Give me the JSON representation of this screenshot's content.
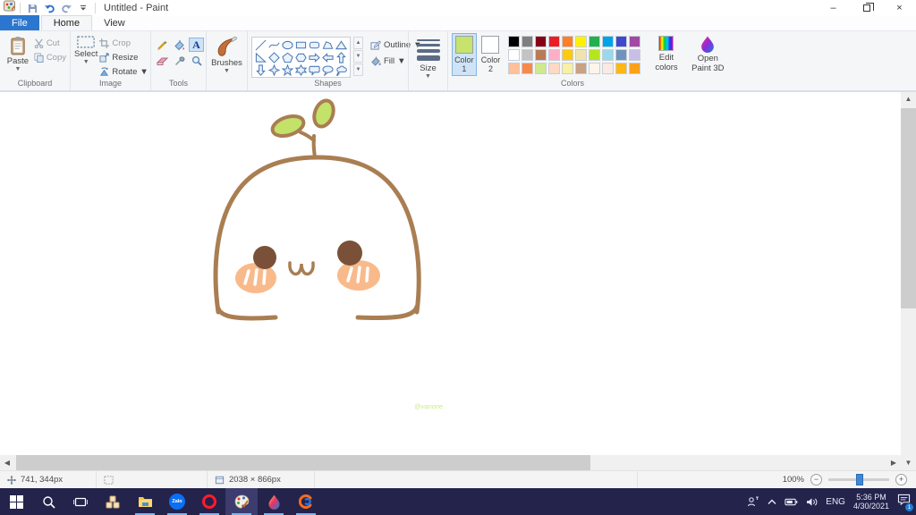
{
  "window": {
    "title": "Untitled - Paint"
  },
  "quick_access": {
    "save": "Save",
    "undo": "Undo",
    "redo": "Redo",
    "customize": "Customize Quick Access Toolbar"
  },
  "tabs": {
    "file": "File",
    "home": "Home",
    "view": "View"
  },
  "ribbon": {
    "clipboard": {
      "label": "Clipboard",
      "paste": "Paste",
      "cut": "Cut",
      "copy": "Copy"
    },
    "image": {
      "label": "Image",
      "select": "Select",
      "crop": "Crop",
      "resize": "Resize",
      "rotate": "Rotate"
    },
    "tools": {
      "label": "Tools",
      "items": [
        "pencil",
        "fill-bucket",
        "text",
        "eraser",
        "eyedropper",
        "magnifier"
      ],
      "selected": "text"
    },
    "brushes": {
      "label": "Brushes"
    },
    "shapes": {
      "label": "Shapes",
      "items": [
        "line",
        "curve",
        "ellipse",
        "rectangle",
        "rounded-rectangle",
        "polygon",
        "triangle",
        "right-triangle",
        "diamond",
        "pentagon",
        "hexagon",
        "arrow-right",
        "arrow-left",
        "arrow-up",
        "arrow-down",
        "star-4",
        "star-5",
        "star-6",
        "callout-rounded",
        "callout-oval",
        "callout-cloud"
      ],
      "outline": "Outline",
      "fill": "Fill"
    },
    "size": {
      "label": "Size"
    },
    "colors": {
      "label": "Colors",
      "color1": {
        "line1": "Color",
        "line2": "1",
        "value": "#c6e36d"
      },
      "color2": {
        "line1": "Color",
        "line2": "2",
        "value": "#ffffff"
      },
      "palette_rows": [
        [
          "#000000",
          "#7f7f7f",
          "#880015",
          "#ed1c24",
          "#ff7f27",
          "#fff200",
          "#22b14c",
          "#00a2e8",
          "#3f48cc",
          "#a349a4"
        ],
        [
          "#ffffff",
          "#c3c3c3",
          "#b97a57",
          "#ffaec9",
          "#ffc90e",
          "#efe4b0",
          "#b5e61d",
          "#99d9ea",
          "#7092be",
          "#c8bfe7"
        ],
        [
          "#ffc09a",
          "#f68a4c",
          "#cfe98c",
          "#ffd9c4",
          "#f8f0a2",
          "#c9a184",
          "#fdf5ec",
          "#fbe9e4",
          "#fdb813",
          "#f9a11b"
        ]
      ],
      "edit_colors_line1": "Edit",
      "edit_colors_line2": "colors",
      "open_line1": "Open",
      "open_line2": "Paint 3D"
    }
  },
  "canvas": {
    "signature": "@vanone",
    "artwork_colors": {
      "outline": "#a97e52",
      "eye": "#7a5138",
      "cheek": "#f9ba8b",
      "leaf": "#c3e26a",
      "stripe": "#ffffff",
      "signature": "#cdea8e"
    }
  },
  "status_bar": {
    "cursor_position": "741, 344px",
    "image_size": "2038 × 866px",
    "zoom": "100%"
  },
  "taskbar": {
    "apps": [
      {
        "name": "start",
        "running": false,
        "active": false
      },
      {
        "name": "search",
        "running": false,
        "active": false
      },
      {
        "name": "task-view",
        "running": false,
        "active": false
      },
      {
        "name": "tiles-app",
        "running": false,
        "active": false
      },
      {
        "name": "file-explorer",
        "running": true,
        "active": false
      },
      {
        "name": "zalo",
        "running": true,
        "active": false
      },
      {
        "name": "opera",
        "running": true,
        "active": false
      },
      {
        "name": "paint",
        "running": true,
        "active": true
      },
      {
        "name": "paint-3d",
        "running": true,
        "active": false
      },
      {
        "name": "swirl-app",
        "running": true,
        "active": false
      }
    ],
    "zalo_label": "Zalo",
    "tray": {
      "language": "ENG",
      "time": "5:36 PM",
      "date": "4/30/2021",
      "notification_badge": "1"
    }
  }
}
